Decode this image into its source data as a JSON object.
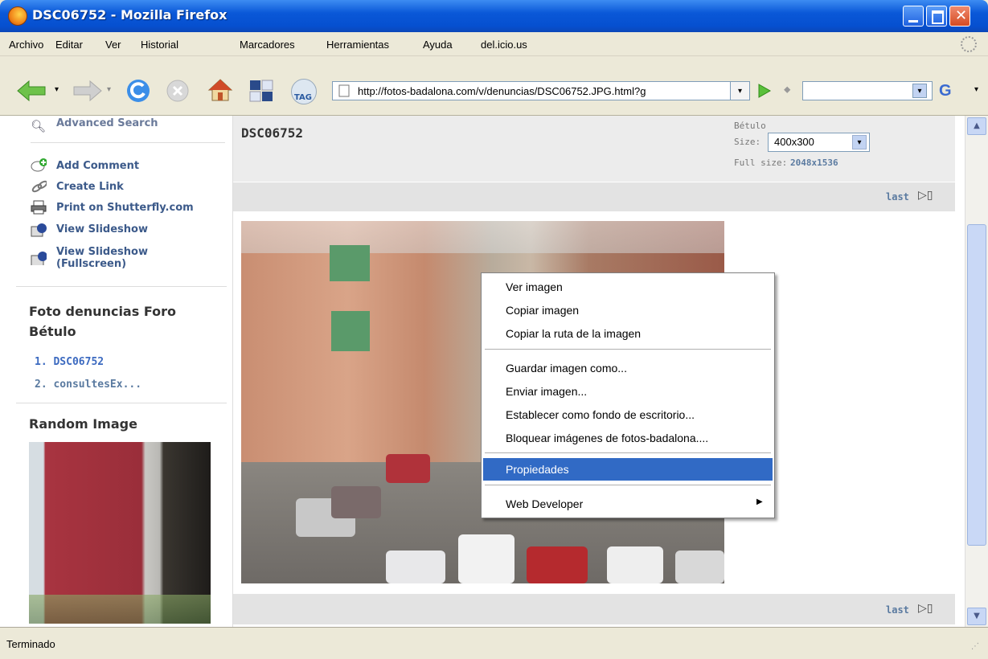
{
  "window": {
    "title": "DSC06752 - Mozilla Firefox"
  },
  "menubar": {
    "items": [
      "Archivo",
      "Editar",
      "Ver",
      "Historial",
      "Marcadores",
      "Herramientas",
      "Ayuda",
      "del.icio.us"
    ]
  },
  "toolbar": {
    "url": "http://fotos-badalona.com/v/denuncias/DSC06752.JPG.html?g",
    "tag_label": "TAG",
    "search_placeholder": "",
    "search_engine": "G"
  },
  "sidebar": {
    "actions": [
      "Advanced Search",
      "Add Comment",
      "Create Link",
      "Print on Shutterfly.com",
      "View Slideshow",
      "View Slideshow",
      "(Fullscreen)"
    ],
    "album_title_1": "Foto denuncias Foro",
    "album_title_2": "Bétulo",
    "album_items": [
      "1. DSC06752",
      "2. consultesEx..."
    ],
    "random_title": "Random Image"
  },
  "main": {
    "photo_title": "DSC06752",
    "breadcrumb": "Bétulo",
    "size_label": "Size:",
    "size_value": "400x300",
    "full_size_label": "Full size:",
    "full_size_value": "2048x1536",
    "nav_last": "last"
  },
  "context_menu": {
    "items": [
      "Ver imagen",
      "Copiar imagen",
      "Copiar la ruta de la imagen",
      "Guardar imagen como...",
      "Enviar imagen...",
      "Establecer como fondo de escritorio...",
      "Bloquear imágenes de fotos-badalona....",
      "Propiedades",
      "Web Developer"
    ],
    "selected": "Propiedades"
  },
  "status": {
    "text": "Terminado"
  },
  "colors": {
    "titlebar": "#0a58d8",
    "selection": "#316ac5",
    "link": "#3c5a8a",
    "band": "#e7e7e7"
  }
}
